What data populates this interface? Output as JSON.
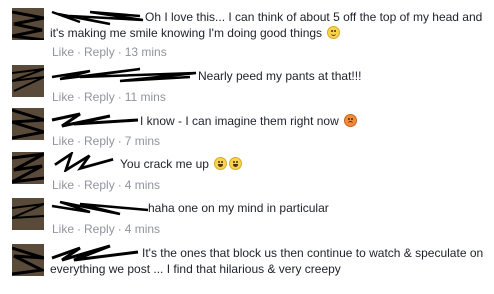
{
  "comments": [
    {
      "text": "Oh I love this... I can think of about 5 off the top of my head and it's making me smile knowing I'm doing good things",
      "emoji": "smile-emoji-icon",
      "like": "Like",
      "reply": "Reply",
      "time": "13 mins"
    },
    {
      "text": "Nearly peed my pants at that!!!",
      "emoji": "",
      "like": "Like",
      "reply": "Reply",
      "time": "11 mins"
    },
    {
      "text": "I know - I can imagine them right now",
      "emoji": "angry-emoji-icon",
      "like": "Like",
      "reply": "Reply",
      "time": "7 mins"
    },
    {
      "text": "You crack me up",
      "emoji": "laughing-emoji-icon",
      "like": "Like",
      "reply": "Reply",
      "time": "4 mins"
    },
    {
      "text": "haha one on my mind in particular",
      "emoji": "",
      "like": "Like",
      "reply": "Reply",
      "time": "4 mins"
    },
    {
      "text": "It's the ones that block us then continue to watch & speculate on everything we post ... I find that hilarious & very creepy",
      "emoji": "",
      "like": "",
      "reply": "",
      "time": ""
    }
  ],
  "meta_separator": "·",
  "colors": {
    "meta": "#90949c",
    "text": "#1d2129",
    "redaction": "#000000"
  }
}
